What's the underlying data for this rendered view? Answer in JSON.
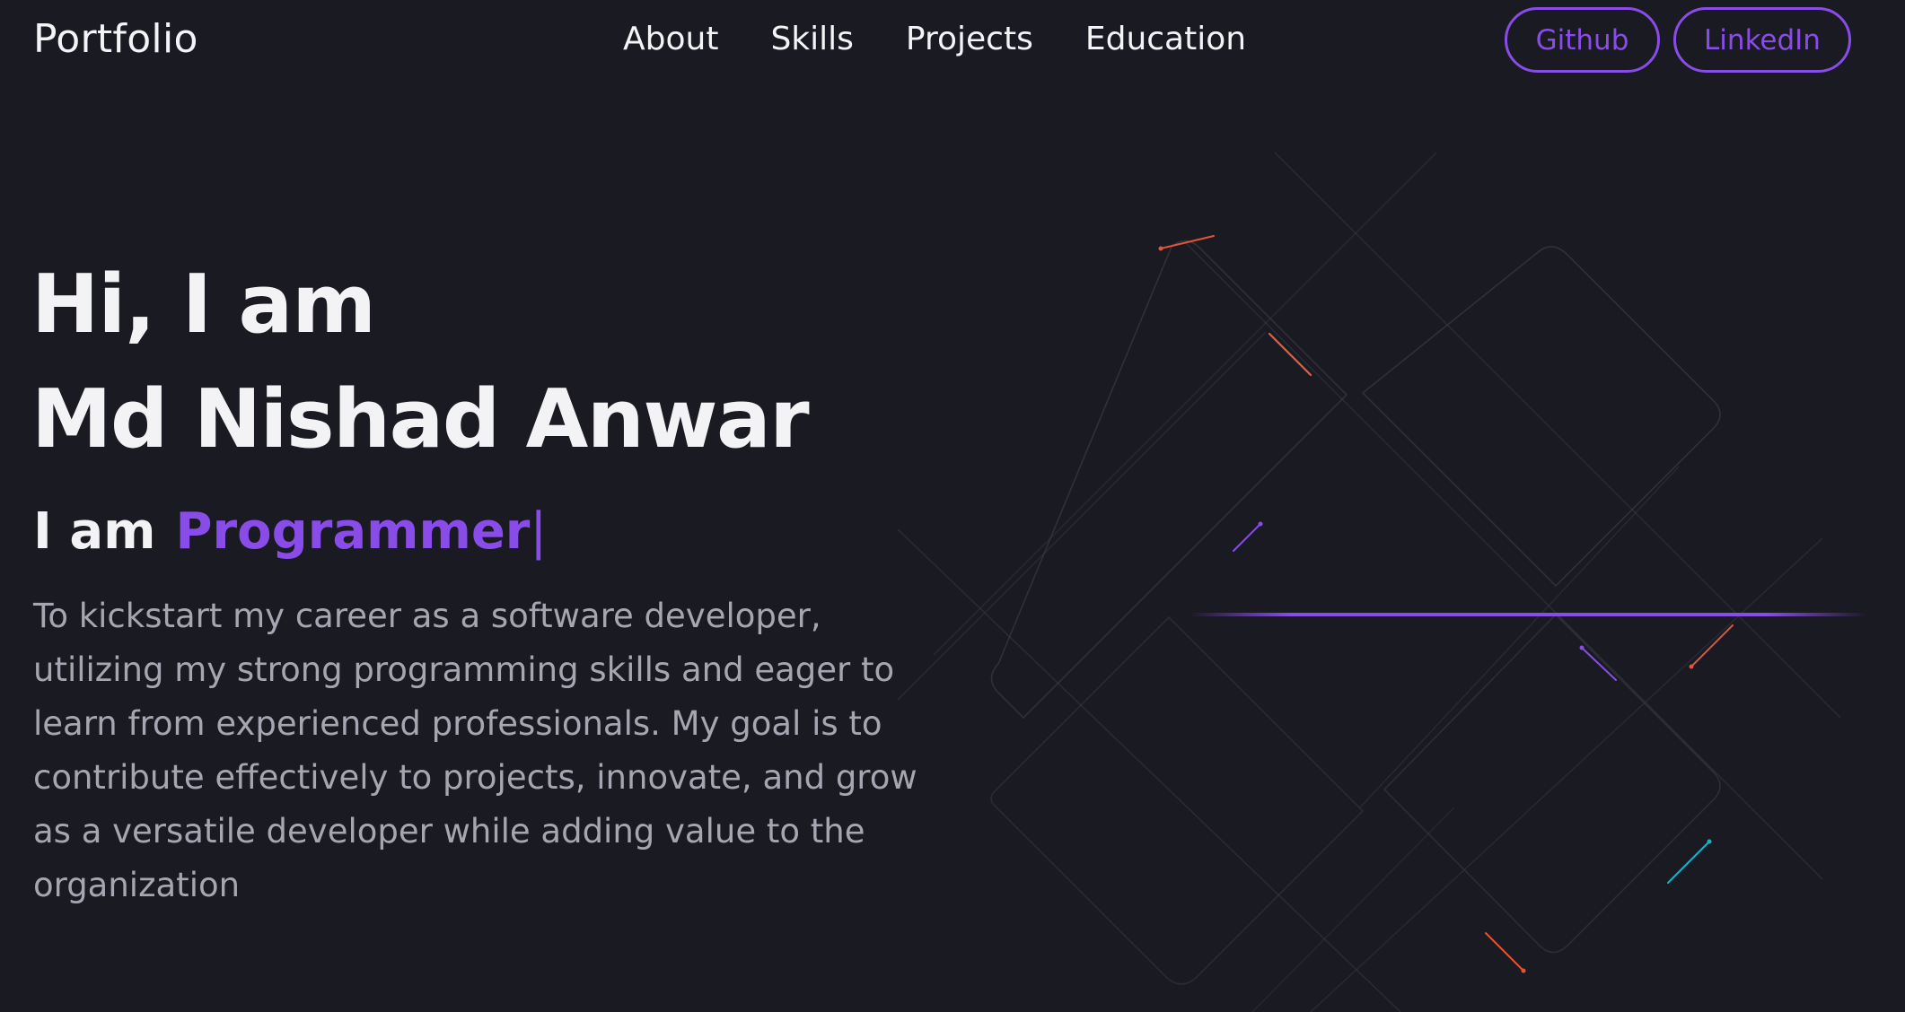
{
  "header": {
    "brand": "Portfolio",
    "nav": [
      {
        "label": "About"
      },
      {
        "label": "Skills"
      },
      {
        "label": "Projects"
      },
      {
        "label": "Education"
      }
    ],
    "buttons": {
      "github": "Github",
      "linkedin": "LinkedIn"
    }
  },
  "hero": {
    "greeting": "Hi, I am",
    "name": "Md Nishad Anwar",
    "role_prefix": "I am",
    "role_typed": "Programmer",
    "cursor": "|",
    "bio": "To kickstart my career as a software developer, utilizing my strong programming skills and eager to learn from experienced professionals. My goal is to contribute effectively to projects, innovate, and grow as a versatile developer while adding value to the organization"
  },
  "colors": {
    "background": "#1a1a22",
    "accent": "#8a4ce8",
    "text": "#f3f3f5",
    "muted": "#a6a6b2"
  }
}
